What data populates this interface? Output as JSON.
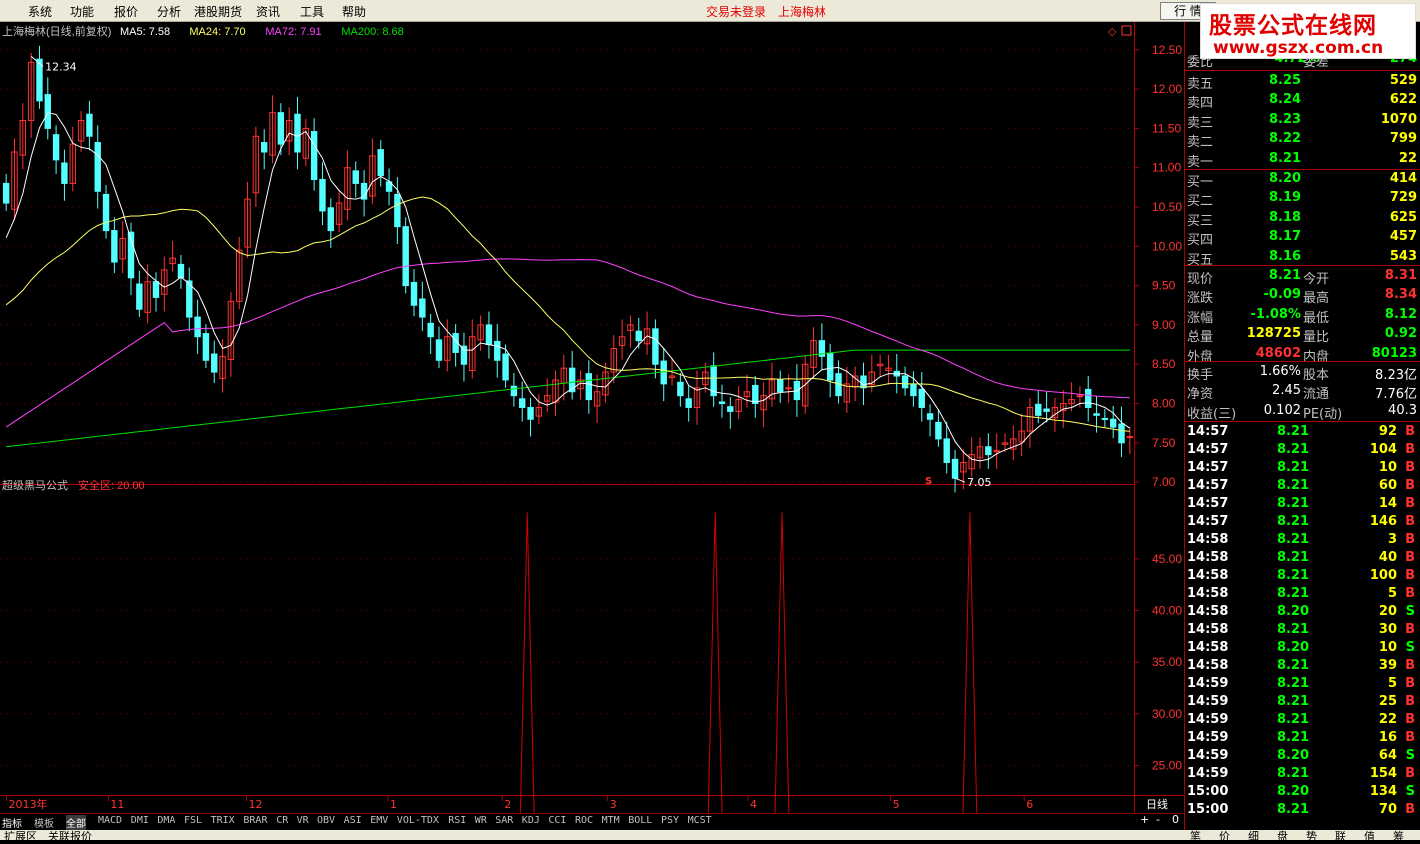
{
  "menu": {
    "items": [
      "系统",
      "功能",
      "报价",
      "分析",
      "港股期货",
      "资讯",
      "工具",
      "帮助"
    ],
    "trade_status": "交易未登录",
    "stock": "上海梅林",
    "quote_button": "行 情"
  },
  "watermark": {
    "line1": "股票公式在线网",
    "line2": "www.gszx.com.cn"
  },
  "colors": {
    "up": "#ff3232",
    "down": "#54ffff",
    "ma5": "#ffffff",
    "ma24": "#ffff66",
    "ma72": "#ff40ff",
    "ma200": "#00e000",
    "axis": "#b00000",
    "label_red": "#ff3232",
    "grid": "#500000"
  },
  "main_chart": {
    "title": "上海梅林(日线,前复权)",
    "ma_labels": [
      {
        "text": "MA5: 7.58",
        "color": "#ffffff"
      },
      {
        "text": "MA24: 7.70",
        "color": "#ffff66"
      },
      {
        "text": "MA72: 7.91",
        "color": "#ff40ff"
      },
      {
        "text": "MA200: 8.68",
        "color": "#00e000"
      }
    ],
    "y_ticks": [
      "12.50",
      "12.00",
      "11.50",
      "11.00",
      "10.50",
      "10.00",
      "9.50",
      "9.00",
      "8.50",
      "8.00",
      "7.50",
      "7.00"
    ],
    "high_label": "12.34",
    "low_label": "7.05",
    "marker": "S",
    "ylim": [
      6.9,
      12.65
    ]
  },
  "indicator": {
    "title": "超级黑马公式",
    "sub": "安全区: 20.00",
    "y_ticks": [
      "45.00",
      "40.00",
      "35.00",
      "30.00",
      "25.00"
    ],
    "ylim": [
      20.5,
      50.5
    ],
    "spike_value": 49.5,
    "spike_positions": [
      0.464,
      0.63,
      0.689,
      0.855
    ]
  },
  "x_axis": {
    "labels": [
      {
        "t": "2013年",
        "p": 0.004
      },
      {
        "t": "11",
        "p": 0.094
      },
      {
        "t": "12",
        "p": 0.216
      },
      {
        "t": "1",
        "p": 0.341
      },
      {
        "t": "2",
        "p": 0.442
      },
      {
        "t": "3",
        "p": 0.535
      },
      {
        "t": "4",
        "p": 0.659
      },
      {
        "t": "5",
        "p": 0.785
      },
      {
        "t": "6",
        "p": 0.903
      }
    ],
    "period": "日线"
  },
  "tabs": [
    "指标",
    "模板",
    "全部",
    "MACD",
    "DMI",
    "DMA",
    "FSL",
    "TRIX",
    "BRAR",
    "CR",
    "VR",
    "OBV",
    "ASI",
    "EMV",
    "VOL-TDX",
    "RSI",
    "WR",
    "SAR",
    "KDJ",
    "CCI",
    "ROC",
    "MTM",
    "BOLL",
    "PSY",
    "MCST"
  ],
  "bottom": [
    "扩展区",
    "关联报价"
  ],
  "nav": [
    "+",
    "-",
    "0"
  ],
  "panel": {
    "wei": {
      "l1": "委比",
      "v1": "-4.72%",
      "l2": "委差",
      "v2": "-274"
    },
    "sell": [
      {
        "l": "卖五",
        "p": "8.25",
        "v": "529"
      },
      {
        "l": "卖四",
        "p": "8.24",
        "v": "622"
      },
      {
        "l": "卖三",
        "p": "8.23",
        "v": "1070"
      },
      {
        "l": "卖二",
        "p": "8.22",
        "v": "799"
      },
      {
        "l": "卖一",
        "p": "8.21",
        "v": "22"
      }
    ],
    "buy": [
      {
        "l": "买一",
        "p": "8.20",
        "v": "414"
      },
      {
        "l": "买二",
        "p": "8.19",
        "v": "729"
      },
      {
        "l": "买三",
        "p": "8.18",
        "v": "625"
      },
      {
        "l": "买四",
        "p": "8.17",
        "v": "457"
      },
      {
        "l": "买五",
        "p": "8.16",
        "v": "543"
      }
    ],
    "stats": [
      {
        "l1": "现价",
        "v1": "8.21",
        "c1": "#00ff00",
        "l2": "今开",
        "v2": "8.31",
        "c2": "#ff3232"
      },
      {
        "l1": "涨跌",
        "v1": "-0.09",
        "c1": "#00ff00",
        "l2": "最高",
        "v2": "8.34",
        "c2": "#ff3232"
      },
      {
        "l1": "涨幅",
        "v1": "-1.08%",
        "c1": "#00ff00",
        "l2": "最低",
        "v2": "8.12",
        "c2": "#00ff00"
      },
      {
        "l1": "总量",
        "v1": "128725",
        "c1": "#ffff00",
        "l2": "量比",
        "v2": "0.92",
        "c2": "#00ff00"
      },
      {
        "l1": "外盘",
        "v1": "48602",
        "c1": "#ff3232",
        "l2": "内盘",
        "v2": "80123",
        "c2": "#00ff00"
      }
    ],
    "stats2": [
      {
        "l1": "换手",
        "v1": "1.66%",
        "l2": "股本",
        "v2": "8.23亿"
      },
      {
        "l1": "净资",
        "v1": "2.45",
        "l2": "流通",
        "v2": "7.76亿"
      },
      {
        "l1": "收益(三)",
        "v1": "0.102",
        "l2": "PE(动)",
        "v2": "40.3"
      }
    ],
    "ticks": [
      {
        "t": "14:57",
        "p": "8.21",
        "v": "92",
        "d": "B"
      },
      {
        "t": "14:57",
        "p": "8.21",
        "v": "104",
        "d": "B"
      },
      {
        "t": "14:57",
        "p": "8.21",
        "v": "10",
        "d": "B"
      },
      {
        "t": "14:57",
        "p": "8.21",
        "v": "60",
        "d": "B"
      },
      {
        "t": "14:57",
        "p": "8.21",
        "v": "14",
        "d": "B"
      },
      {
        "t": "14:57",
        "p": "8.21",
        "v": "146",
        "d": "B"
      },
      {
        "t": "14:58",
        "p": "8.21",
        "v": "3",
        "d": "B"
      },
      {
        "t": "14:58",
        "p": "8.21",
        "v": "40",
        "d": "B"
      },
      {
        "t": "14:58",
        "p": "8.21",
        "v": "100",
        "d": "B"
      },
      {
        "t": "14:58",
        "p": "8.21",
        "v": "5",
        "d": "B"
      },
      {
        "t": "14:58",
        "p": "8.20",
        "v": "20",
        "d": "S"
      },
      {
        "t": "14:58",
        "p": "8.21",
        "v": "30",
        "d": "B"
      },
      {
        "t": "14:58",
        "p": "8.20",
        "v": "10",
        "d": "S"
      },
      {
        "t": "14:58",
        "p": "8.21",
        "v": "39",
        "d": "B"
      },
      {
        "t": "14:59",
        "p": "8.21",
        "v": "5",
        "d": "B"
      },
      {
        "t": "14:59",
        "p": "8.21",
        "v": "25",
        "d": "B"
      },
      {
        "t": "14:59",
        "p": "8.21",
        "v": "22",
        "d": "B"
      },
      {
        "t": "14:59",
        "p": "8.21",
        "v": "16",
        "d": "B"
      },
      {
        "t": "14:59",
        "p": "8.20",
        "v": "64",
        "d": "S"
      },
      {
        "t": "14:59",
        "p": "8.21",
        "v": "154",
        "d": "B"
      },
      {
        "t": "15:00",
        "p": "8.20",
        "v": "134",
        "d": "S"
      },
      {
        "t": "15:00",
        "p": "8.21",
        "v": "70",
        "d": "B"
      }
    ],
    "side_tabs": [
      "笔",
      "价",
      "细",
      "盘",
      "势",
      "联",
      "值",
      "筹"
    ]
  },
  "chart_data": {
    "type": "candlestick",
    "closes": [
      10.55,
      11.2,
      11.6,
      12.34,
      11.85,
      11.5,
      11.1,
      10.8,
      11.3,
      11.6,
      11.4,
      10.7,
      10.2,
      9.8,
      10.1,
      9.6,
      9.2,
      9.55,
      9.35,
      9.7,
      9.85,
      9.6,
      9.1,
      8.85,
      8.55,
      8.4,
      8.6,
      9.3,
      9.95,
      10.6,
      11.4,
      11.2,
      11.7,
      11.3,
      11.6,
      11.2,
      11.5,
      10.85,
      10.45,
      10.2,
      10.55,
      11.0,
      10.8,
      10.6,
      11.15,
      10.9,
      10.7,
      10.25,
      9.5,
      9.25,
      9.1,
      8.85,
      8.55,
      8.85,
      8.65,
      8.5,
      8.85,
      9.0,
      8.75,
      8.55,
      8.3,
      8.1,
      7.95,
      7.8,
      7.95,
      8.1,
      8.3,
      8.45,
      8.15,
      8.3,
      8.05,
      8.15,
      8.4,
      8.7,
      8.85,
      9.0,
      8.8,
      8.95,
      8.5,
      8.25,
      8.35,
      8.1,
      7.95,
      8.2,
      8.4,
      8.1,
      8.0,
      7.9,
      8.05,
      8.15,
      8.0,
      8.1,
      8.3,
      8.15,
      8.2,
      8.05,
      8.5,
      8.8,
      8.6,
      8.3,
      8.1,
      8.25,
      8.35,
      8.2,
      8.4,
      8.5,
      8.45,
      8.35,
      8.2,
      8.1,
      7.95,
      7.8,
      7.55,
      7.25,
      7.05,
      7.25,
      7.35,
      7.45,
      7.35,
      7.4,
      7.5,
      7.55,
      7.65,
      7.95,
      7.85,
      7.9,
      7.95,
      8.0,
      8.05,
      8.1,
      7.95,
      7.85,
      7.8,
      7.7,
      7.5,
      7.58
    ]
  }
}
